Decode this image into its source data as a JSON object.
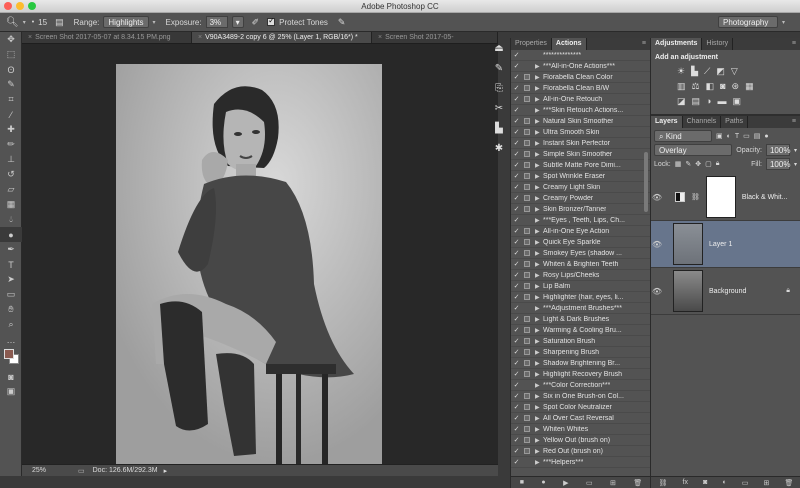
{
  "window": {
    "title": "Adobe Photoshop CC"
  },
  "options": {
    "tool_size": "15",
    "range_label": "Range:",
    "range_value": "Highlights",
    "exposure_label": "Exposure:",
    "exposure_value": "3%",
    "protect_tones_label": "Protect Tones",
    "protect_tones_checked": true,
    "workspace": "Photography"
  },
  "doc_tabs": [
    {
      "label": "Screen Shot 2017-05-07 at 8.34.15 PM.png",
      "active": false
    },
    {
      "label": "V90A3489-2 copy 6 @ 25% (Layer 1, RGB/16*) *",
      "active": true
    },
    {
      "label": "Screen Shot 2017-05-",
      "active": false
    }
  ],
  "status": {
    "zoom": "25%",
    "doc": "Doc: 126.6M/292.3M"
  },
  "actions_panel": {
    "tabs": [
      "Properties",
      "Actions"
    ],
    "active_tab": "Actions",
    "rows": [
      {
        "label": "**************",
        "check": true,
        "toggle": false,
        "arrow": false
      },
      {
        "label": "***All-in-One Actions***",
        "check": true,
        "toggle": false,
        "arrow": true
      },
      {
        "label": "Florabella Clean Color",
        "check": true,
        "toggle": true,
        "arrow": true
      },
      {
        "label": "Florabella Clean B/W",
        "check": true,
        "toggle": true,
        "arrow": true
      },
      {
        "label": "All-in-One Retouch",
        "check": true,
        "toggle": true,
        "arrow": true
      },
      {
        "label": "***Skin Retouch Actions...",
        "check": true,
        "toggle": false,
        "arrow": true
      },
      {
        "label": "Natural Skin Smoother",
        "check": true,
        "toggle": true,
        "arrow": true
      },
      {
        "label": "Ultra Smooth Skin",
        "check": true,
        "toggle": true,
        "arrow": true
      },
      {
        "label": "Instant Skin Perfector",
        "check": true,
        "toggle": true,
        "arrow": true
      },
      {
        "label": "Simple Skin Smoother",
        "check": true,
        "toggle": true,
        "arrow": true
      },
      {
        "label": "Subtle Matte Pore Dimi...",
        "check": true,
        "toggle": true,
        "arrow": true
      },
      {
        "label": "Spot Wrinkle Eraser",
        "check": true,
        "toggle": true,
        "arrow": true
      },
      {
        "label": "Creamy Light Skin",
        "check": true,
        "toggle": true,
        "arrow": true
      },
      {
        "label": "Creamy Powder",
        "check": true,
        "toggle": true,
        "arrow": true
      },
      {
        "label": "Skin Bronzer/Tanner",
        "check": true,
        "toggle": true,
        "arrow": true
      },
      {
        "label": "***Eyes , Teeth, Lips, Ch...",
        "check": true,
        "toggle": false,
        "arrow": true
      },
      {
        "label": "All-in-One Eye Action",
        "check": true,
        "toggle": true,
        "arrow": true
      },
      {
        "label": "Quick Eye Sparkle",
        "check": true,
        "toggle": true,
        "arrow": true
      },
      {
        "label": "Smokey Eyes (shadow ...",
        "check": true,
        "toggle": true,
        "arrow": true
      },
      {
        "label": "Whiten & Brighten Teeth",
        "check": true,
        "toggle": true,
        "arrow": true
      },
      {
        "label": "Rosy Lips/Cheeks",
        "check": true,
        "toggle": true,
        "arrow": true
      },
      {
        "label": "Lip Balm",
        "check": true,
        "toggle": true,
        "arrow": true
      },
      {
        "label": "Highlighter (hair, eyes, li...",
        "check": true,
        "toggle": true,
        "arrow": true
      },
      {
        "label": "***Adjustment Brushes***",
        "check": true,
        "toggle": false,
        "arrow": true
      },
      {
        "label": "Light & Dark Brushes",
        "check": true,
        "toggle": true,
        "arrow": true
      },
      {
        "label": "Warming & Cooling Bru...",
        "check": true,
        "toggle": true,
        "arrow": true
      },
      {
        "label": "Saturation Brush",
        "check": true,
        "toggle": true,
        "arrow": true
      },
      {
        "label": "Sharpening Brush",
        "check": true,
        "toggle": true,
        "arrow": true
      },
      {
        "label": "Shadow Brightening Br...",
        "check": true,
        "toggle": true,
        "arrow": true
      },
      {
        "label": "Highlight Recovery Brush",
        "check": true,
        "toggle": true,
        "arrow": true
      },
      {
        "label": "***Color Correction***",
        "check": true,
        "toggle": false,
        "arrow": true
      },
      {
        "label": "Six in One Brush-on Col...",
        "check": true,
        "toggle": true,
        "arrow": true
      },
      {
        "label": "Spot Color Neutralizer",
        "check": true,
        "toggle": true,
        "arrow": true
      },
      {
        "label": "All Over Cast Reversal",
        "check": true,
        "toggle": true,
        "arrow": true
      },
      {
        "label": "Whiten Whites",
        "check": true,
        "toggle": true,
        "arrow": true
      },
      {
        "label": "Yellow Out (brush on)",
        "check": true,
        "toggle": true,
        "arrow": true
      },
      {
        "label": "Red Out (brush on)",
        "check": true,
        "toggle": true,
        "arrow": true
      },
      {
        "label": "***Helpers***",
        "check": true,
        "toggle": false,
        "arrow": true
      }
    ]
  },
  "adjustments_panel": {
    "tabs": [
      "Adjustments",
      "History"
    ],
    "title": "Add an adjustment"
  },
  "layers_panel": {
    "tabs": [
      "Layers",
      "Channels",
      "Paths"
    ],
    "filter": "Kind",
    "blend_mode": "Overlay",
    "opacity_label": "Opacity:",
    "opacity": "100%",
    "lock_label": "Lock:",
    "fill_label": "Fill:",
    "fill": "100%",
    "layers": [
      {
        "name": "Black & Whit...",
        "selected": false,
        "type": "adjustment"
      },
      {
        "name": "Layer 1",
        "selected": true,
        "type": "pixel"
      },
      {
        "name": "Background",
        "selected": false,
        "type": "background"
      }
    ]
  }
}
